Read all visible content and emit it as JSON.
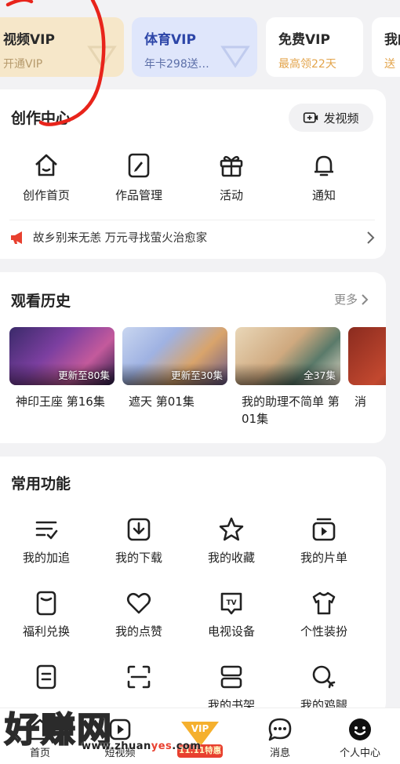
{
  "vip_cards": [
    {
      "title": "视频VIP",
      "subtitle": "开通VIP"
    },
    {
      "title": "体育VIP",
      "subtitle": "年卡298送…"
    },
    {
      "title": "免费VIP",
      "subtitle": "最高领22天"
    },
    {
      "title": "我的",
      "subtitle": "送"
    }
  ],
  "creation": {
    "title": "创作中心",
    "post_label": "发视频",
    "items": [
      {
        "label": "创作首页",
        "icon": "home-icon"
      },
      {
        "label": "作品管理",
        "icon": "edit-icon"
      },
      {
        "label": "活动",
        "icon": "gift-icon"
      },
      {
        "label": "通知",
        "icon": "bell-icon"
      }
    ],
    "announcement": "故乡别来无恙 万元寻找萤火治愈家"
  },
  "history": {
    "title": "观看历史",
    "more_label": "更多",
    "items": [
      {
        "name": "神印王座 第16集",
        "badge": "更新至80集"
      },
      {
        "name": "遮天 第01集",
        "badge": "更新至30集"
      },
      {
        "name": "我的助理不简单 第01集",
        "badge": "全37集"
      },
      {
        "name": "消",
        "badge": ""
      }
    ]
  },
  "functions": {
    "title": "常用功能",
    "rows": [
      [
        {
          "label": "我的加追",
          "icon": "list-check-icon"
        },
        {
          "label": "我的下载",
          "icon": "download-icon"
        },
        {
          "label": "我的收藏",
          "icon": "star-icon"
        },
        {
          "label": "我的片单",
          "icon": "playlist-icon"
        }
      ],
      [
        {
          "label": "福利兑换",
          "icon": "coupon-icon"
        },
        {
          "label": "我的点赞",
          "icon": "heart-icon"
        },
        {
          "label": "电视设备",
          "icon": "tv-icon"
        },
        {
          "label": "个性装扮",
          "icon": "shirt-icon"
        }
      ],
      [
        {
          "label": "",
          "icon": "document-icon"
        },
        {
          "label": "",
          "icon": "scan-icon"
        },
        {
          "label": "我的书架",
          "icon": "bookshelf-icon"
        },
        {
          "label": "我的鸡腿",
          "icon": "drumstick-icon"
        }
      ]
    ]
  },
  "bottom_nav": [
    {
      "label": "首页",
      "icon": "home-nav-icon"
    },
    {
      "label": "短视频",
      "icon": "short-video-icon"
    },
    {
      "label": "",
      "icon": "vip-promo-icon",
      "vip_text": "VIP",
      "promo_text": "11.11特惠"
    },
    {
      "label": "消息",
      "icon": "message-icon"
    },
    {
      "label": "个人中心",
      "icon": "profile-icon"
    }
  ],
  "watermark": {
    "text": "好赚网",
    "url_prefix": "www.zhuan",
    "url_highlight": "yes",
    "url_suffix": ".com"
  },
  "colors": {
    "accent_red": "#e8402f",
    "vip_gold_bg": "#f6e7c9",
    "sport_blue_bg": "#dfe6fb",
    "highlight_orange": "#e3a44b"
  }
}
